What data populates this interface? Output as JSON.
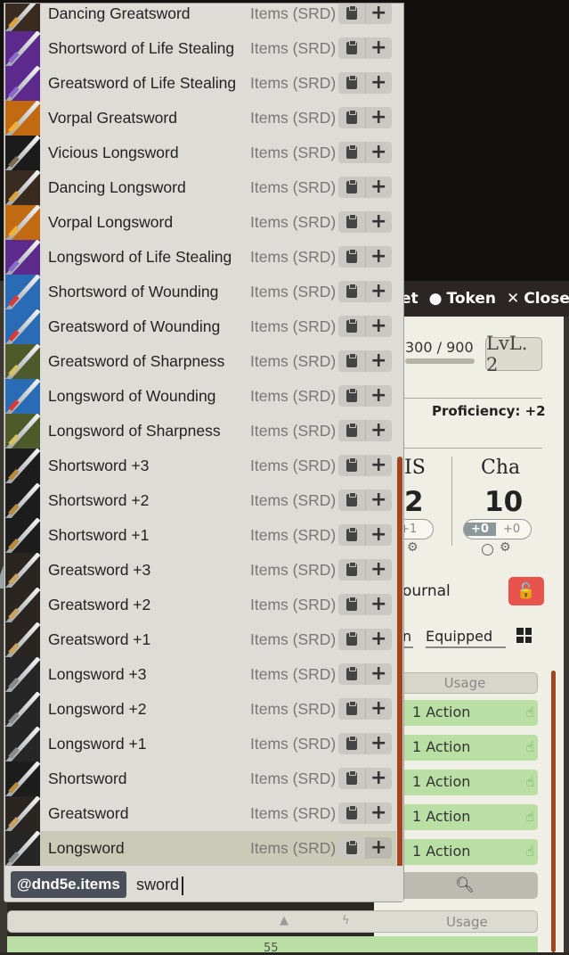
{
  "autocomplete": {
    "items": [
      {
        "name": "Dancing Greatsword",
        "source": "Items (SRD)",
        "thumb": "#3a2b20",
        "hilt": "#d9a23a"
      },
      {
        "name": "Shortsword of Life Stealing",
        "source": "Items (SRD)",
        "thumb": "#5b2a8c",
        "hilt": "#8a6cc8"
      },
      {
        "name": "Greatsword of Life Stealing",
        "source": "Items (SRD)",
        "thumb": "#5b2a8c",
        "hilt": "#8a6cc8"
      },
      {
        "name": "Vorpal Greatsword",
        "source": "Items (SRD)",
        "thumb": "#c26a12",
        "hilt": "#f0b030"
      },
      {
        "name": "Vicious Longsword",
        "source": "Items (SRD)",
        "thumb": "#1b1b1b",
        "hilt": "#7a6a52"
      },
      {
        "name": "Dancing Longsword",
        "source": "Items (SRD)",
        "thumb": "#3a2b20",
        "hilt": "#d9a23a"
      },
      {
        "name": "Vorpal Longsword",
        "source": "Items (SRD)",
        "thumb": "#c26a12",
        "hilt": "#f0b030"
      },
      {
        "name": "Longsword of Life Stealing",
        "source": "Items (SRD)",
        "thumb": "#5b2a8c",
        "hilt": "#8a6cc8"
      },
      {
        "name": "Shortsword of Wounding",
        "source": "Items (SRD)",
        "thumb": "#2a6bb5",
        "hilt": "#d83a3a"
      },
      {
        "name": "Greatsword of Wounding",
        "source": "Items (SRD)",
        "thumb": "#2a6bb5",
        "hilt": "#d83a3a"
      },
      {
        "name": "Greatsword of Sharpness",
        "source": "Items (SRD)",
        "thumb": "#4f5a2a",
        "hilt": "#d8c060"
      },
      {
        "name": "Longsword of Wounding",
        "source": "Items (SRD)",
        "thumb": "#2a6bb5",
        "hilt": "#d83a3a"
      },
      {
        "name": "Longsword of Sharpness",
        "source": "Items (SRD)",
        "thumb": "#4f5a2a",
        "hilt": "#d8c060"
      },
      {
        "name": "Shortsword +3",
        "source": "Items (SRD)",
        "thumb": "#1d1d1d",
        "hilt": "#b88a3c"
      },
      {
        "name": "Shortsword +2",
        "source": "Items (SRD)",
        "thumb": "#1d1d1d",
        "hilt": "#b88a3c"
      },
      {
        "name": "Shortsword +1",
        "source": "Items (SRD)",
        "thumb": "#1d1d1d",
        "hilt": "#b88a3c"
      },
      {
        "name": "Greatsword +3",
        "source": "Items (SRD)",
        "thumb": "#2a2520",
        "hilt": "#caa060"
      },
      {
        "name": "Greatsword +2",
        "source": "Items (SRD)",
        "thumb": "#2a2520",
        "hilt": "#caa060"
      },
      {
        "name": "Greatsword +1",
        "source": "Items (SRD)",
        "thumb": "#2a2520",
        "hilt": "#caa060"
      },
      {
        "name": "Longsword +3",
        "source": "Items (SRD)",
        "thumb": "#262626",
        "hilt": "#8a8a8a"
      },
      {
        "name": "Longsword +2",
        "source": "Items (SRD)",
        "thumb": "#262626",
        "hilt": "#8a8a8a"
      },
      {
        "name": "Longsword +1",
        "source": "Items (SRD)",
        "thumb": "#262626",
        "hilt": "#8a8a8a"
      },
      {
        "name": "Shortsword",
        "source": "Items (SRD)",
        "thumb": "#1d1d1d",
        "hilt": "#b88a3c"
      },
      {
        "name": "Greatsword",
        "source": "Items (SRD)",
        "thumb": "#2a2520",
        "hilt": "#caa060"
      },
      {
        "name": "Longsword",
        "source": "Items (SRD)",
        "thumb": "#262626",
        "hilt": "#8a8a8a",
        "selected": true
      }
    ],
    "row_icons": {
      "copy": "clipboard-icon",
      "add": "plus-icon"
    },
    "plus_glyph": "+",
    "compendium_badge": "@dnd5e.items",
    "query": "sword"
  },
  "sheet": {
    "header": {
      "partial_label": "et",
      "token_label": "Token",
      "close_label": "Close"
    },
    "xp": "300 / 900",
    "level": "LvL. 2",
    "proficiency": "Proficiency: +2",
    "abilities": [
      {
        "label": "IS",
        "score": "2",
        "mods": [
          "+1"
        ]
      },
      {
        "label": "Cha",
        "score": "10",
        "mods": [
          "+0",
          "+0"
        ]
      }
    ],
    "journal_label": "ournal",
    "tabs": {
      "partial": "n",
      "equipped": "Equipped"
    },
    "usage_header": "Usage",
    "actions": [
      "1 Action",
      "1 Action",
      "1 Action",
      "1 Action",
      "1 Action"
    ],
    "bottom_usage": "Usage",
    "bottom_number": "55"
  },
  "colors": {
    "popup_bg": "#dddcd7",
    "selected_row": "#cbcab6",
    "scrollbar": "#a24521",
    "badge_bg": "#4a4f5a",
    "action_green": "#b9dfa5",
    "lock_red": "#e8534e"
  }
}
